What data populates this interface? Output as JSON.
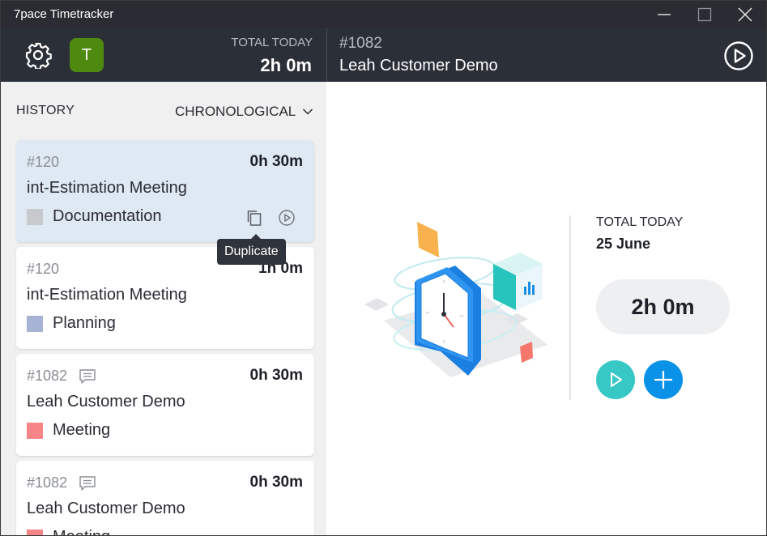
{
  "app": {
    "title": "7pace Timetracker"
  },
  "header": {
    "avatar_letter": "T",
    "total_today_label": "TOTAL TODAY",
    "total_today_value": "2h 0m",
    "current_task_id": "#1082",
    "current_task_name": "Leah Customer Demo"
  },
  "history": {
    "label": "HISTORY",
    "sort_label": "CHRONOLOGICAL",
    "tooltip": "Duplicate",
    "items": [
      {
        "id": "#120",
        "time": "0h 30m",
        "title": "int-Estimation Meeting",
        "category": "Documentation",
        "color": "#c8c9cc",
        "has_comment": false
      },
      {
        "id": "#120",
        "time": "1h 0m",
        "title": "int-Estimation Meeting",
        "category": "Planning",
        "color": "#a6b3d4",
        "has_comment": false
      },
      {
        "id": "#1082",
        "time": "0h 30m",
        "title": "Leah Customer Demo",
        "category": "Meeting",
        "color": "#f78486",
        "has_comment": true
      },
      {
        "id": "#1082",
        "time": "0h 30m",
        "title": "Leah Customer Demo",
        "category": "Meeting",
        "color": "#f78486",
        "has_comment": true
      }
    ]
  },
  "summary": {
    "total_today_label": "TOTAL TODAY",
    "date": "25 June",
    "total_value": "2h 0m"
  },
  "colors": {
    "titlebar": "#2b2c33",
    "header": "#2b2f38",
    "avatar": "#4f8a10",
    "play_button": "#37c8c6",
    "add_button": "#0a91e8",
    "active_card": "#dfe9f3"
  }
}
